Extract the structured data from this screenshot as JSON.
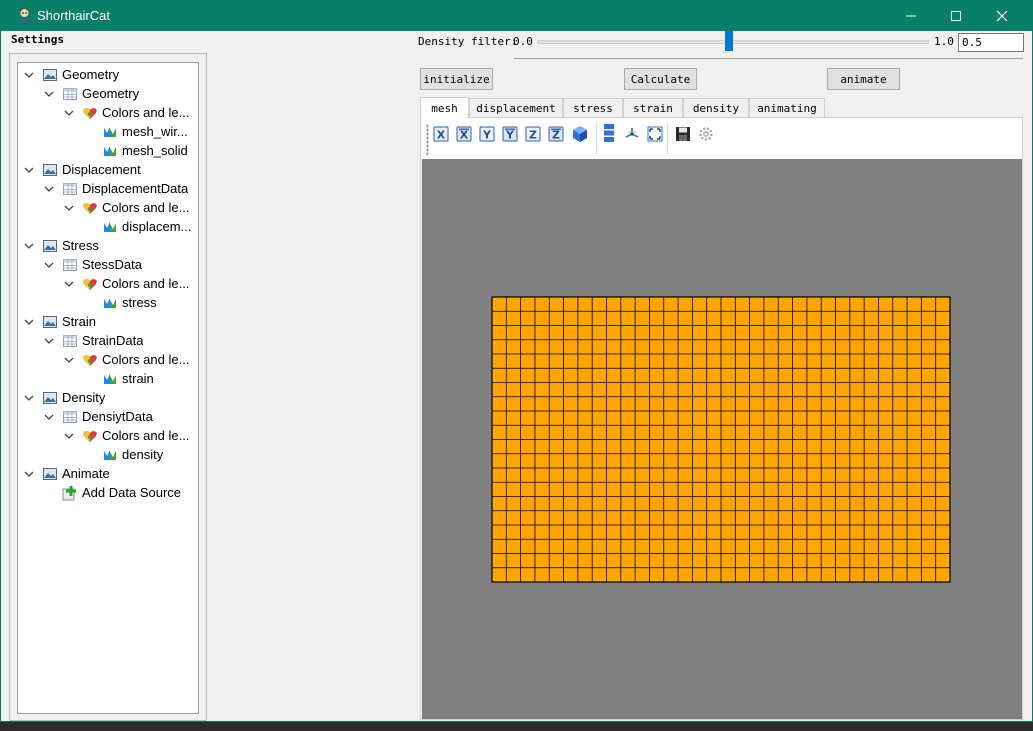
{
  "window": {
    "title": "ShorthairCat",
    "controls": [
      "minimize-icon",
      "maximize-icon",
      "close-icon"
    ],
    "titlebar_color": "#087f68"
  },
  "settings": {
    "label": "Settings",
    "tree": [
      {
        "label": "Geometry",
        "icon": "image-icon",
        "level": 0,
        "expanded": true
      },
      {
        "label": "Geometry",
        "icon": "table-icon",
        "level": 1,
        "expanded": true
      },
      {
        "label": "Colors and le...",
        "icon": "palette-heart-icon",
        "level": 2,
        "expanded": true
      },
      {
        "label": "mesh_wir...",
        "icon": "chart-series-icon",
        "level": 3
      },
      {
        "label": "mesh_solid",
        "icon": "chart-series-icon",
        "level": 3
      },
      {
        "label": "Displacement",
        "icon": "image-icon",
        "level": 0,
        "expanded": true
      },
      {
        "label": "DisplacementData",
        "icon": "table-icon",
        "level": 1,
        "expanded": true
      },
      {
        "label": "Colors and le...",
        "icon": "palette-heart-icon",
        "level": 2,
        "expanded": true
      },
      {
        "label": "displacem...",
        "icon": "chart-series-icon",
        "level": 3
      },
      {
        "label": "Stress",
        "icon": "image-icon",
        "level": 0,
        "expanded": true
      },
      {
        "label": "StessData",
        "icon": "table-icon",
        "level": 1,
        "expanded": true
      },
      {
        "label": "Colors and le...",
        "icon": "palette-heart-icon",
        "level": 2,
        "expanded": true
      },
      {
        "label": "stress",
        "icon": "chart-series-icon",
        "level": 3
      },
      {
        "label": "Strain",
        "icon": "image-icon",
        "level": 0,
        "expanded": true
      },
      {
        "label": "StrainData",
        "icon": "table-icon",
        "level": 1,
        "expanded": true
      },
      {
        "label": "Colors and le...",
        "icon": "palette-heart-icon",
        "level": 2,
        "expanded": true
      },
      {
        "label": "strain",
        "icon": "chart-series-icon",
        "level": 3
      },
      {
        "label": "Density",
        "icon": "image-icon",
        "level": 0,
        "expanded": true
      },
      {
        "label": "DensiytData",
        "icon": "table-icon",
        "level": 1,
        "expanded": true
      },
      {
        "label": "Colors and le...",
        "icon": "palette-heart-icon",
        "level": 2,
        "expanded": true
      },
      {
        "label": "density",
        "icon": "chart-series-icon",
        "level": 3
      },
      {
        "label": "Animate",
        "icon": "image-icon",
        "level": 0,
        "expanded": true
      },
      {
        "label": "Add Data Source",
        "icon": "add-plus-icon",
        "level": 1
      }
    ]
  },
  "density_filter": {
    "label": "Density filter:",
    "min": "0.0",
    "max": "1.0",
    "value": "0.5",
    "slider_fraction": 0.5
  },
  "actions": {
    "initialize": "initialize",
    "calculate": "Calculate",
    "animate": "animate"
  },
  "tabs": [
    "mesh",
    "displacement",
    "stress",
    "strain",
    "density",
    "animating"
  ],
  "active_tab": "mesh",
  "toolbar": [
    "view-x-icon",
    "view-neg-x-icon",
    "view-y-icon",
    "view-neg-y-icon",
    "view-z-icon",
    "view-neg-z-icon",
    "isometric-cube-icon",
    "stack-icon",
    "axes-icon",
    "fit-view-icon",
    "save-icon",
    "settings-gear-icon"
  ],
  "mesh": {
    "columns": 32,
    "rows": 20,
    "fill_color": "#ffa500",
    "edge_color": "#000000",
    "background_color": "#808080"
  }
}
